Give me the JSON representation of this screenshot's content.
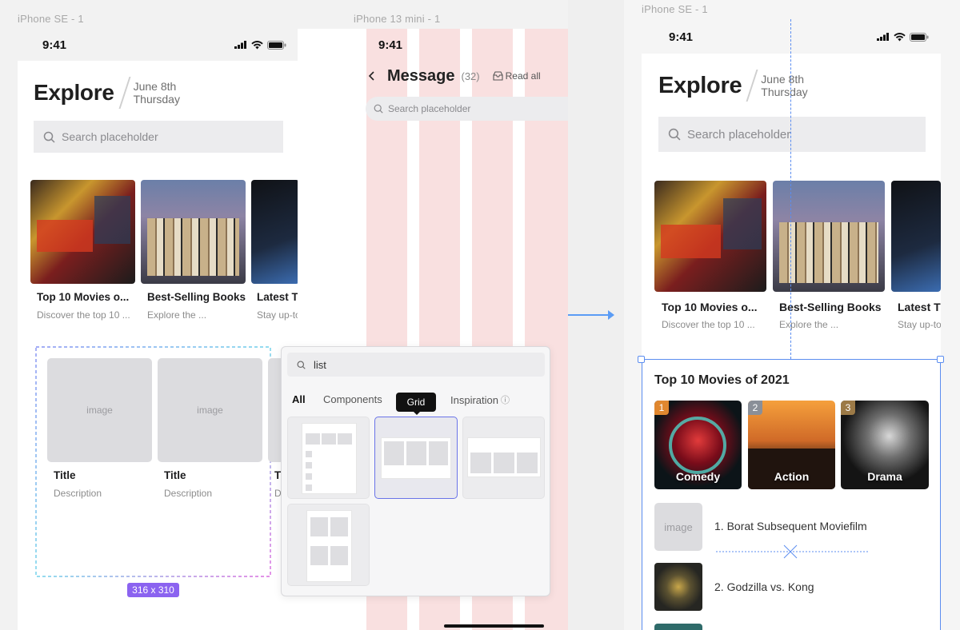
{
  "frames": {
    "left": {
      "label": "iPhone SE - 1",
      "time": "9:41",
      "title": "Explore",
      "date1": "June 8th",
      "date2": "Thursday",
      "search_placeholder": "Search placeholder",
      "cards": [
        {
          "title": "Top 10 Movies o...",
          "desc": "Discover the top 10 ..."
        },
        {
          "title": "Best-Selling Books",
          "desc": "Explore the ..."
        },
        {
          "title": "Latest T",
          "desc": "Stay up-to"
        }
      ],
      "grid_items": [
        {
          "image": "image",
          "title": "Title",
          "desc": "Description"
        },
        {
          "image": "image",
          "title": "Title",
          "desc": "Description"
        },
        {
          "title": "T",
          "desc": "D"
        }
      ],
      "size_badge": "316 x 310"
    },
    "middle": {
      "label": "iPhone 13 mini - 1",
      "time": "9:41",
      "title": "Message",
      "count": "(32)",
      "read_all": "Read all",
      "search_placeholder": "Search placeholder"
    },
    "right": {
      "label": "iPhone SE - 1",
      "time": "9:41",
      "title": "Explore",
      "date1": "June 8th",
      "date2": "Thursday",
      "search_placeholder": "Search placeholder",
      "cards": [
        {
          "title": "Top 10 Movies o...",
          "desc": "Discover the top 10 ..."
        },
        {
          "title": "Best-Selling Books",
          "desc": "Explore the ..."
        },
        {
          "title": "Latest T",
          "desc": "Stay up-to"
        }
      ],
      "section_title": "Top 10 Movies of 2021",
      "genres": [
        {
          "num": "1",
          "label": "Comedy"
        },
        {
          "num": "2",
          "label": "Action"
        },
        {
          "num": "3",
          "label": "Drama"
        }
      ],
      "list": [
        {
          "thumb": "image",
          "text": "1. Borat Subsequent Moviefilm"
        },
        {
          "text": "2. Godzilla vs. Kong"
        }
      ]
    }
  },
  "panel": {
    "search_value": "list",
    "tabs": [
      "All",
      "Components",
      "Grid",
      "Inspiration"
    ],
    "tooltip": "Grid",
    "info_glyph": "ⓘ"
  },
  "colors": {
    "accent": "#5b8df0",
    "badge": "#8b63f0",
    "arrow": "#5b9cf5",
    "number_tag_orange": "#e0872f",
    "number_tag_gray": "#8a8f98",
    "number_tag_brown": "#9c7a47"
  }
}
